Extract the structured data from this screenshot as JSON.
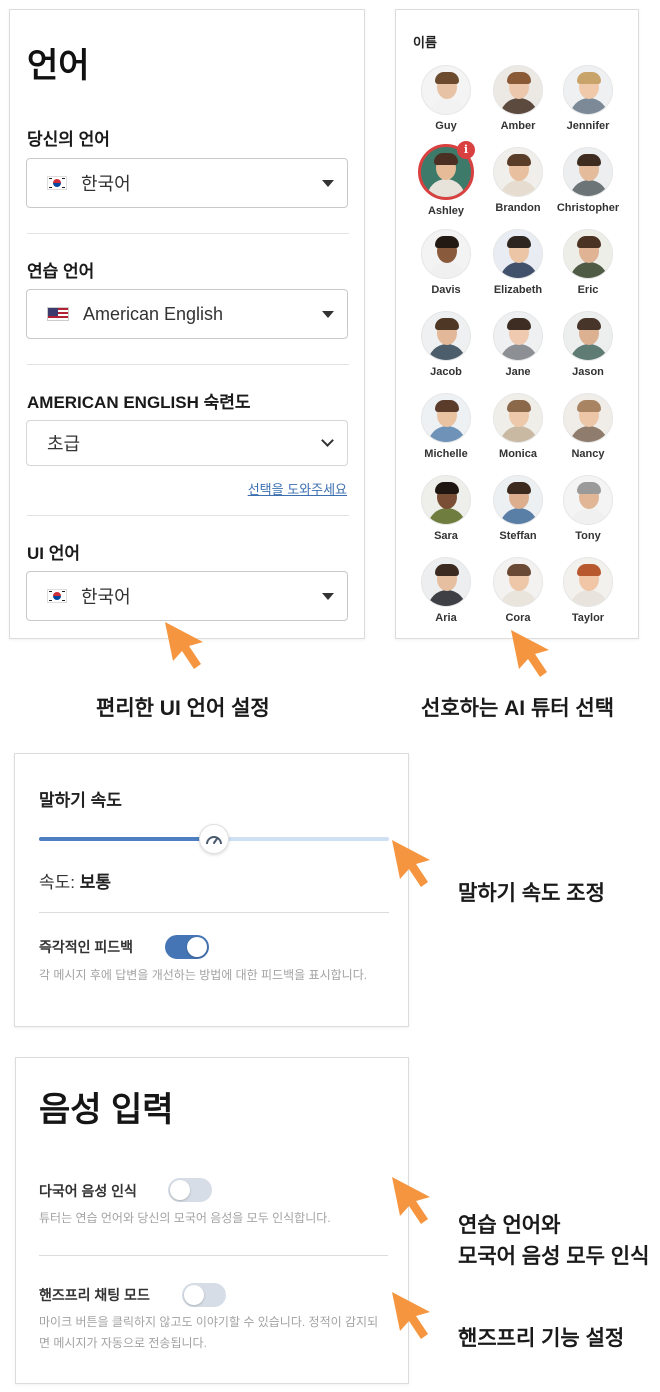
{
  "language_panel": {
    "title": "언어",
    "your_language": {
      "label": "당신의 언어",
      "value": "한국어",
      "flag": "kr-flag-icon"
    },
    "practice_language": {
      "label": "연습 언어",
      "value": "American English",
      "flag": "us-flag-icon"
    },
    "proficiency": {
      "label": "AMERICAN ENGLISH 숙련도",
      "value": "초급",
      "help_link": "선택을 도와주세요"
    },
    "ui_language": {
      "label": "UI 언어",
      "value": "한국어",
      "flag": "kr-flag-icon"
    }
  },
  "tutor_panel": {
    "heading": "이름",
    "tutors": [
      {
        "name": "Guy",
        "skin": "#e8c2a4",
        "hair": "#6b4a2e",
        "shirt": "#f2f2f2",
        "bg": "#f4f4f4"
      },
      {
        "name": "Amber",
        "skin": "#edc7ab",
        "hair": "#8a5a36",
        "shirt": "#5d4a3f",
        "bg": "#ece8e4"
      },
      {
        "name": "Jennifer",
        "skin": "#f0c9ab",
        "hair": "#c9a46a",
        "shirt": "#7b8a96",
        "bg": "#eef0f1"
      },
      {
        "name": "Ashley",
        "skin": "#e6bc98",
        "hair": "#4a2f22",
        "shirt": "#e8e3da",
        "bg": "#3d7a6a",
        "selected": true
      },
      {
        "name": "Brandon",
        "skin": "#e8c0a0",
        "hair": "#5a3d28",
        "shirt": "#e6ddd0",
        "bg": "#f1efeb"
      },
      {
        "name": "Christopher",
        "skin": "#e4bb9b",
        "hair": "#3e2c20",
        "shirt": "#6d7478",
        "bg": "#eceeef"
      },
      {
        "name": "Davis",
        "skin": "#8a5a3c",
        "hair": "#231a14",
        "shirt": "#f0f0f0",
        "bg": "#f3f3f3"
      },
      {
        "name": "Elizabeth",
        "skin": "#ecc4a6",
        "hair": "#2e2420",
        "shirt": "#41506b",
        "bg": "#e9ecf2"
      },
      {
        "name": "Eric",
        "skin": "#dfb393",
        "hair": "#4b3324",
        "shirt": "#4f5b44",
        "bg": "#eeeee9"
      },
      {
        "name": "Jacob",
        "skin": "#e2b898",
        "hair": "#4f3726",
        "shirt": "#4c5e6b",
        "bg": "#eef0f1"
      },
      {
        "name": "Jane",
        "skin": "#efcab0",
        "hair": "#3d2d22",
        "shirt": "#8c8f94",
        "bg": "#eef0f2"
      },
      {
        "name": "Jason",
        "skin": "#dcb192",
        "hair": "#47352a",
        "shirt": "#5e7c74",
        "bg": "#edefee"
      },
      {
        "name": "Michelle",
        "skin": "#e9c2a2",
        "hair": "#5b3b2a",
        "shirt": "#6f93b8",
        "bg": "#eef1f4"
      },
      {
        "name": "Monica",
        "skin": "#eec8aa",
        "hair": "#8a6849",
        "shirt": "#c9b9a3",
        "bg": "#f0eee9"
      },
      {
        "name": "Nancy",
        "skin": "#edc6a8",
        "hair": "#a88462",
        "shirt": "#8f7c6c",
        "bg": "#f0ede9"
      },
      {
        "name": "Sara",
        "skin": "#7a4e34",
        "hair": "#1f1612",
        "shirt": "#6f7d3e",
        "bg": "#eeeeea"
      },
      {
        "name": "Steffan",
        "skin": "#dcae8e",
        "hair": "#3c2a1e",
        "shirt": "#5a7fa6",
        "bg": "#edf0f3"
      },
      {
        "name": "Tony",
        "skin": "#e0b696",
        "hair": "#9a9a9a",
        "shirt": "#f0f0f0",
        "bg": "#f4f4f4"
      },
      {
        "name": "Aria",
        "skin": "#e6bea0",
        "hair": "#3a2a20",
        "shirt": "#3f3f46",
        "bg": "#eceef0"
      },
      {
        "name": "Cora",
        "skin": "#eec7a8",
        "hair": "#6a4a34",
        "shirt": "#e9e4dc",
        "bg": "#f3f2f0"
      },
      {
        "name": "Taylor",
        "skin": "#f0c6a6",
        "hair": "#b8582e",
        "shirt": "#e8e3dc",
        "bg": "#f3f1ee"
      }
    ]
  },
  "captions": {
    "ui_language": "편리한 UI 언어 설정",
    "tutor_select": "선호하는 AI 튜터 선택",
    "speed_adjust": "말하기 속도 조정",
    "dual_recognition_line1": "연습 언어와",
    "dual_recognition_line2": "모국어 음성 모두 인식",
    "handsfree": "핸즈프리 기능 설정"
  },
  "speed_panel": {
    "title": "말하기 속도",
    "speed_label": "속도:",
    "speed_value": "보통",
    "slider_level": 0.5,
    "instant_feedback": {
      "label": "즉각적인 피드백",
      "enabled": true,
      "description": "각 메시지 후에 답변을 개선하는 방법에 대한 피드백을 표시합니다."
    }
  },
  "voice_panel": {
    "title": "음성 입력",
    "multilingual": {
      "label": "다국어 음성 인식",
      "enabled": false,
      "description": "튜터는 연습 언어와 당신의 모국어 음성을 모두 인식합니다."
    },
    "handsfree": {
      "label": "핸즈프리 채팅 모드",
      "enabled": false,
      "description": "마이크 버튼을 클릭하지 않고도 이야기할 수 있습니다. 정적이 감지되면 메시지가 자동으로 전송됩니다."
    }
  },
  "colors": {
    "accent": "#4575b4",
    "arrow": "#f5953f",
    "selected_ring": "#d94040",
    "link": "#3b6fb0"
  }
}
